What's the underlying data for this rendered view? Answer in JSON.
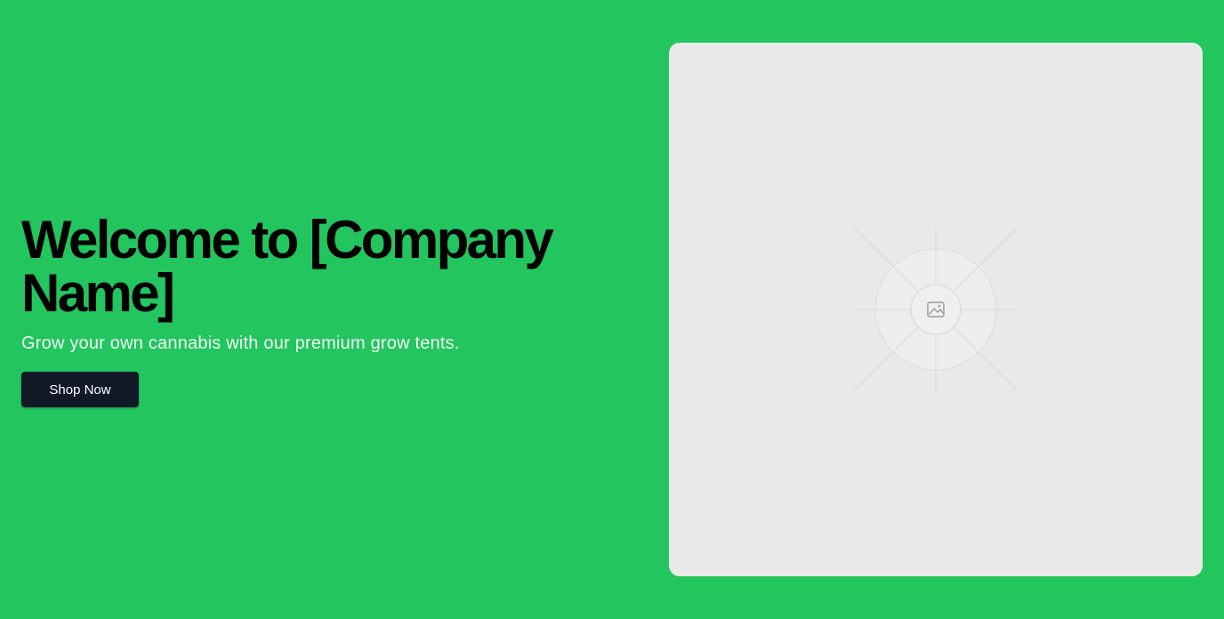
{
  "hero": {
    "title": "Welcome to [Company Name]",
    "subtitle": "Grow your own cannabis with our premium grow tents.",
    "cta_label": "Shop Now"
  },
  "image_placeholder": {
    "icon": "image-icon"
  },
  "colors": {
    "background": "#22c55e",
    "title_text": "#000000",
    "subtitle_text": "#f0fdf4",
    "button_bg": "#111827",
    "button_text": "#ffffff",
    "placeholder_bg": "#e9e9e9"
  }
}
